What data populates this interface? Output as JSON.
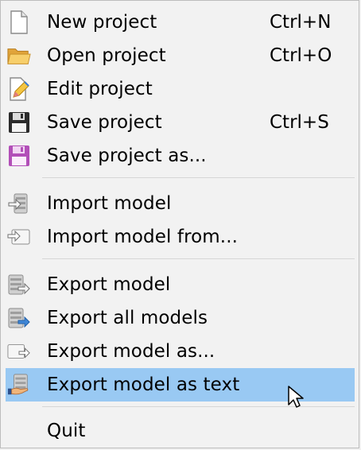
{
  "menu": {
    "items": [
      {
        "label": "New project",
        "shortcut": "Ctrl+N",
        "icon": "new-file-icon"
      },
      {
        "label": "Open project",
        "shortcut": "Ctrl+O",
        "icon": "open-folder-icon"
      },
      {
        "label": "Edit project",
        "shortcut": "",
        "icon": "edit-file-icon"
      },
      {
        "label": "Save project",
        "shortcut": "Ctrl+S",
        "icon": "save-icon"
      },
      {
        "label": "Save project as...",
        "shortcut": "",
        "icon": "save-as-icon"
      },
      {
        "label": "Import model",
        "shortcut": "",
        "icon": "import-icon"
      },
      {
        "label": "Import model from...",
        "shortcut": "",
        "icon": "import-from-icon"
      },
      {
        "label": "Export model",
        "shortcut": "",
        "icon": "export-icon"
      },
      {
        "label": "Export all models",
        "shortcut": "",
        "icon": "export-all-icon"
      },
      {
        "label": "Export model as...",
        "shortcut": "",
        "icon": "export-as-icon"
      },
      {
        "label": "Export model as text",
        "shortcut": "",
        "icon": "export-text-icon",
        "highlighted": true
      },
      {
        "label": "Quit",
        "shortcut": "",
        "icon": ""
      }
    ]
  },
  "colors": {
    "highlight": "#99c9f3",
    "background": "#f2f2f2",
    "separator": "#d6d6d6"
  }
}
